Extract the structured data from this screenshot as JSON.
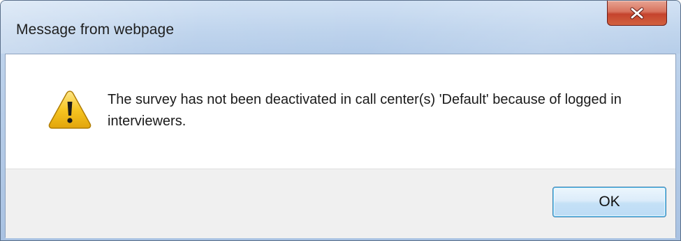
{
  "dialog": {
    "title": "Message from webpage",
    "message": "The survey has not been deactivated in call center(s) 'Default' because of logged in interviewers.",
    "icon": "warning-icon",
    "close_glyph": "x",
    "buttons": {
      "ok_label": "OK"
    }
  },
  "colors": {
    "close_button": "#c7462f",
    "warning_yellow": "#f5c518",
    "button_bar": "#f0f0f0",
    "ok_border": "#3c7fb1"
  }
}
